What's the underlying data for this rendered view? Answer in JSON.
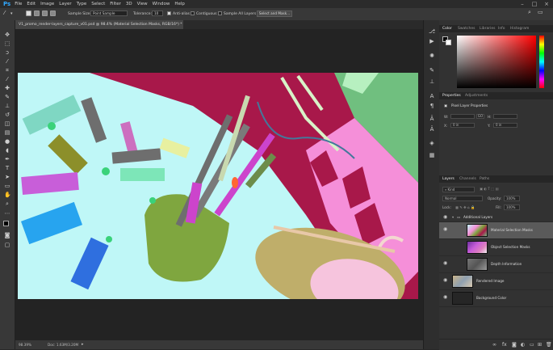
{
  "app": {
    "logo": "Ps",
    "menu": [
      "File",
      "Edit",
      "Image",
      "Layer",
      "Type",
      "Select",
      "Filter",
      "3D",
      "View",
      "Window",
      "Help"
    ]
  },
  "options_bar": {
    "sample_size_label": "Sample Size:",
    "sample_size_value": "Point Sample",
    "tolerance_label": "Tolerance:",
    "tolerance_value": "10",
    "anti_alias_label": "Anti-alias",
    "contiguous_label": "Contiguous",
    "sample_all_layers_label": "Sample All Layers",
    "select_mask_button": "Select and Mask..."
  },
  "document": {
    "tab_title": "V1_promo_render-layers_capture_v01.psd @ 98.4% (Material Selection Masks, RGB/16*) *",
    "zoom": "98.39%",
    "doc_info": "Doc: 1.63M/3.20M"
  },
  "color_panel": {
    "tabs": [
      "Color",
      "Swatches",
      "Libraries",
      "Info",
      "Histogram"
    ],
    "active_tab": "Color"
  },
  "properties_panel": {
    "tabs": [
      "Properties",
      "Adjustments"
    ],
    "active_tab": "Properties",
    "title": "Pixel Layer Properties",
    "w_label": "W:",
    "w_value": "",
    "h_label": "H:",
    "h_value": "",
    "x_label": "X:",
    "x_value": "0 in",
    "y_label": "Y:",
    "y_value": "0 in",
    "link_label": "GO"
  },
  "layers_panel": {
    "tabs": [
      "Layers",
      "Channels",
      "Paths"
    ],
    "active_tab": "Layers",
    "filter_kind": "Kind",
    "blend_mode": "Normal",
    "opacity_label": "Opacity:",
    "opacity_value": "100%",
    "lock_label": "Lock:",
    "fill_label": "Fill:",
    "fill_value": "100%",
    "group_name": "Additional Layers",
    "layers": [
      {
        "name": "Material Selection Masks"
      },
      {
        "name": "Object Selection Masks"
      },
      {
        "name": "Depth Information"
      },
      {
        "name": "Rendered Image"
      },
      {
        "name": "Background Color"
      }
    ]
  },
  "colors": {
    "accent": "#31a8ff",
    "canvas_cyan": "#bff7f7",
    "crimson": "#a8184a",
    "green": "#70bf7f",
    "pink": "#f58fd9",
    "olive": "#7fa63f"
  }
}
